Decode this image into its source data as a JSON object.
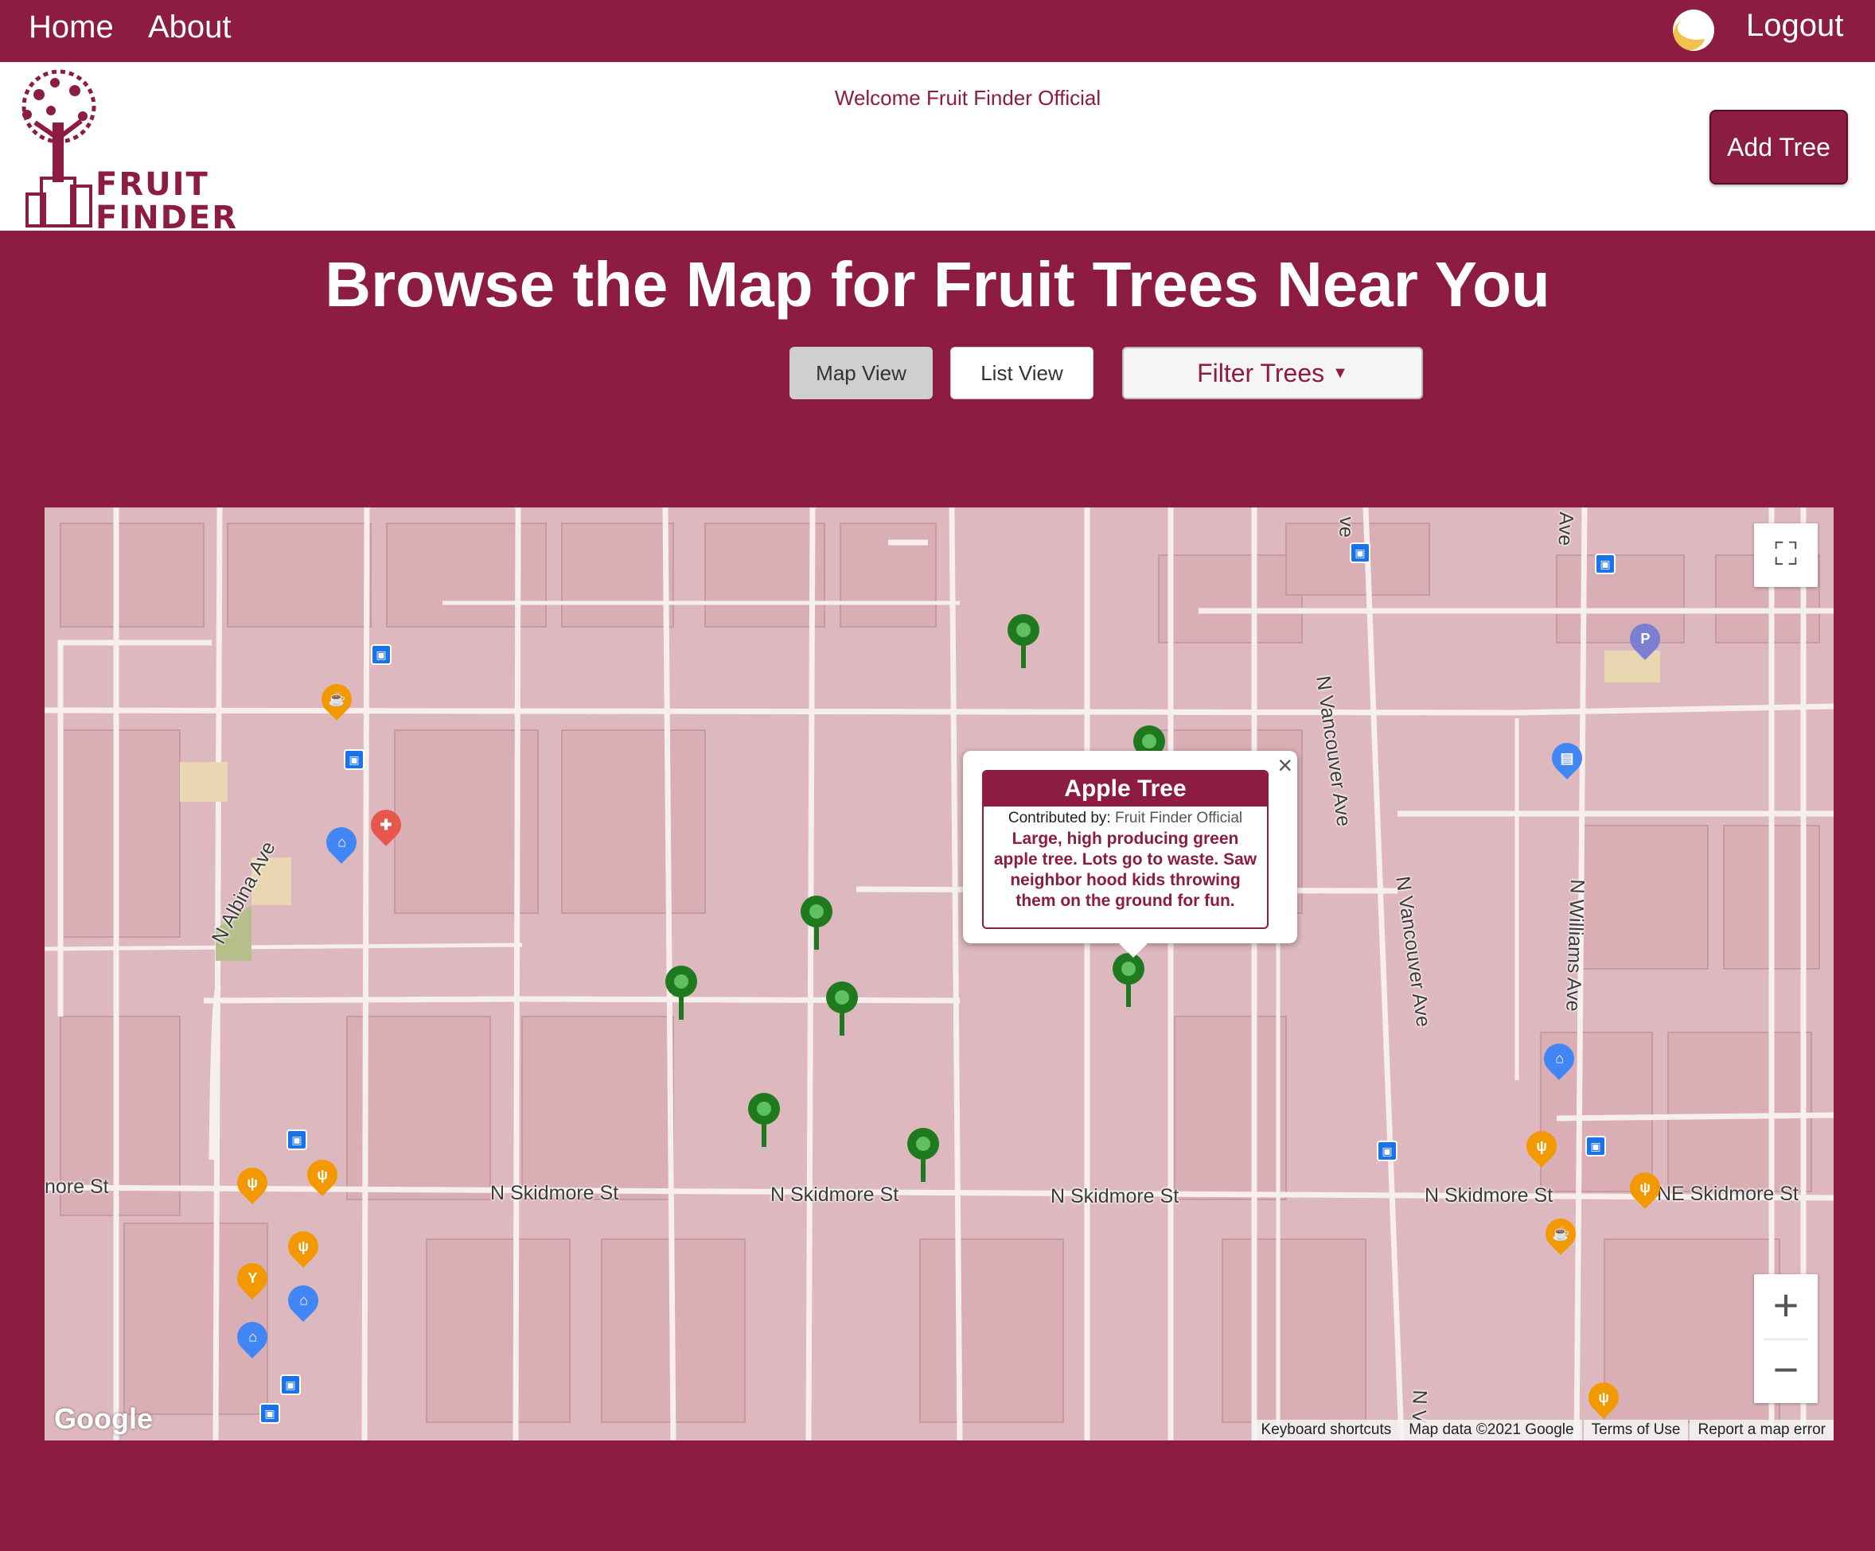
{
  "nav": {
    "home": "Home",
    "about": "About",
    "logout": "Logout"
  },
  "header": {
    "logo_line1": "FRUIT",
    "logo_line2": "FINDER",
    "welcome": "Welcome Fruit Finder Official",
    "add_tree": "Add Tree"
  },
  "page": {
    "title": "Browse the Map for Fruit Trees Near You",
    "map_view": "Map View",
    "list_view": "List View",
    "filter": "Filter Trees"
  },
  "map": {
    "streets": {
      "albina": "N Albina Ave",
      "vancouver": "N Vancouver Ave",
      "williams": "N Williams Ave",
      "skidmore": "N Skidmore St",
      "ne_skidmore": "NE Skidmore St",
      "skidmore_cut": "nore St",
      "ave_top1": "ve",
      "ave_top2": "Ave",
      "n_bottom": "N V"
    },
    "info_window": {
      "title": "Apple Tree",
      "contributed_label": "Contributed by:",
      "contributor": "Fruit Finder Official",
      "description": "Large, high producing green apple tree. Lots go to waste. Saw neighbor hood kids throwing them on the ground for fun."
    },
    "google": "Google",
    "footer": [
      "Keyboard shortcuts",
      "Map data ©2021 Google",
      "Terms of Use",
      "Report a map error"
    ],
    "tree_count": 9,
    "colors": {
      "brand": "#8c1c40",
      "tree": "#1f7a1f",
      "food_poi": "#f29900",
      "shop_poi": "#4285f4"
    }
  }
}
